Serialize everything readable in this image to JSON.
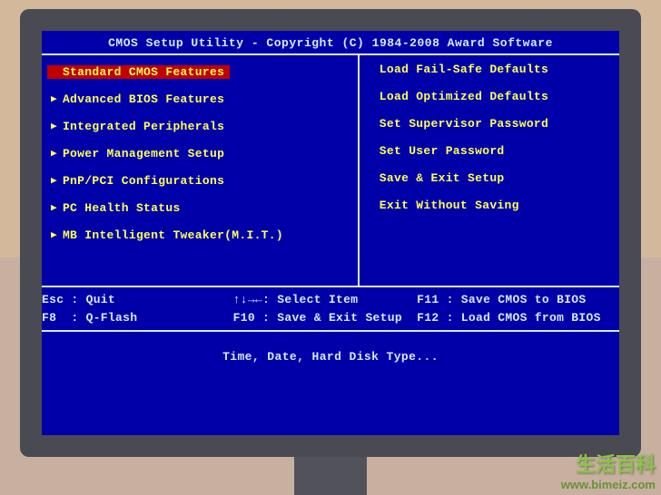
{
  "title": "CMOS Setup Utility - Copyright (C) 1984-2008 Award Software",
  "left_menu": [
    {
      "label": "Standard CMOS Features",
      "selected": true
    },
    {
      "label": "Advanced BIOS Features",
      "selected": false
    },
    {
      "label": "Integrated Peripherals",
      "selected": false
    },
    {
      "label": "Power Management Setup",
      "selected": false
    },
    {
      "label": "PnP/PCI Configurations",
      "selected": false
    },
    {
      "label": "PC Health Status",
      "selected": false
    },
    {
      "label": "MB Intelligent Tweaker(M.I.T.)",
      "selected": false
    }
  ],
  "right_menu": [
    {
      "label": "Load Fail-Safe Defaults"
    },
    {
      "label": "Load Optimized Defaults"
    },
    {
      "label": "Set Supervisor Password"
    },
    {
      "label": "Set User Password"
    },
    {
      "label": "Save & Exit Setup"
    },
    {
      "label": "Exit Without Saving"
    }
  ],
  "keys": {
    "line1": "Esc : Quit                ↑↓→←: Select Item        F11 : Save CMOS to BIOS",
    "line2": "F8  : Q-Flash             F10 : Save & Exit Setup  F12 : Load CMOS from BIOS"
  },
  "help_text": "Time, Date, Hard Disk Type...",
  "watermark": {
    "zh": "生活百科",
    "url": "www.bimeiz.com"
  }
}
